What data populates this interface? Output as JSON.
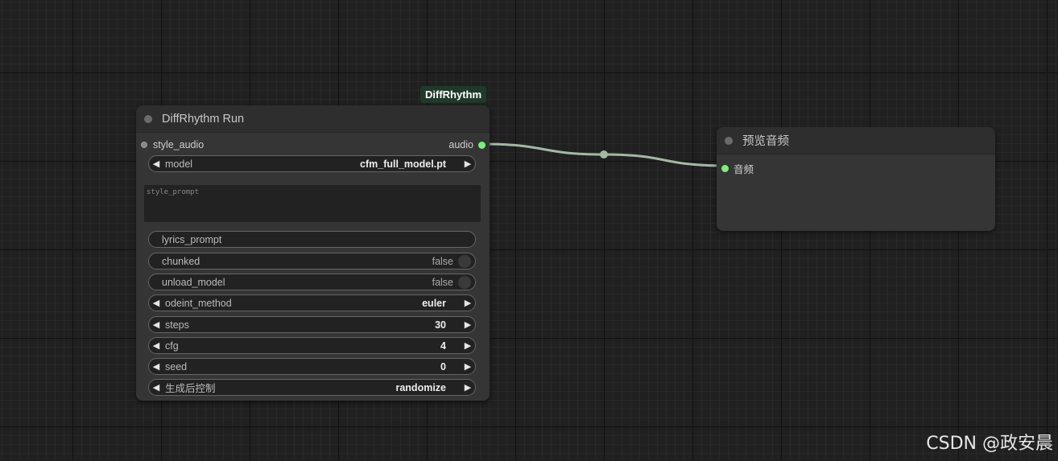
{
  "group": {
    "title": "DiffRhythm"
  },
  "run_node": {
    "title": "DiffRhythm Run",
    "input_slot": "style_audio",
    "output_slot": "audio",
    "model": {
      "label": "model",
      "value": "cfm_full_model.pt"
    },
    "style_prompt": {
      "placeholder": "style_prompt"
    },
    "lyrics_prompt": {
      "label": "lyrics_prompt"
    },
    "chunked": {
      "label": "chunked",
      "value": "false"
    },
    "unload_model": {
      "label": "unload_model",
      "value": "false"
    },
    "odeint_method": {
      "label": "odeint_method",
      "value": "euler"
    },
    "steps": {
      "label": "steps",
      "value": "30"
    },
    "cfg": {
      "label": "cfg",
      "value": "4"
    },
    "seed": {
      "label": "seed",
      "value": "0"
    },
    "control_after_generate": {
      "label": "生成后控制",
      "value": "randomize"
    }
  },
  "preview_node": {
    "title": "预览音频",
    "input_slot": "音频"
  },
  "watermark": "CSDN @政安晨",
  "colors": {
    "slot_audio": "#7af07a",
    "link": "#a4b8a4",
    "group_badge": "#1e3a2a"
  },
  "icons": {
    "decrement": "triangle-left-icon",
    "increment": "triangle-right-icon"
  }
}
